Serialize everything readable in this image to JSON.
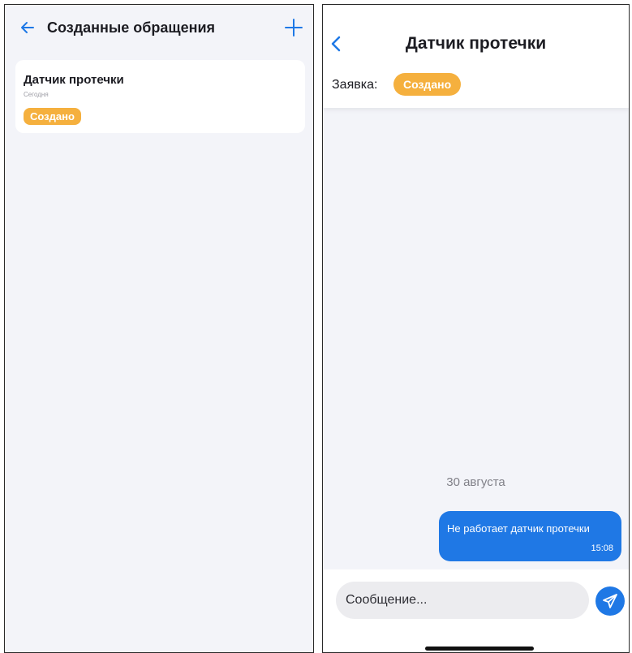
{
  "left": {
    "header": {
      "title": "Созданные обращения"
    },
    "card": {
      "title": "Датчик протечки",
      "date": "Сегодня",
      "status": "Создано"
    }
  },
  "right": {
    "header": {
      "title": "Датчик протечки",
      "request_label": "Заявка:",
      "status": "Создано"
    },
    "chat": {
      "date_separator": "30 августа",
      "messages": [
        {
          "text": "Не работает датчик протечки",
          "time": "15:08"
        }
      ]
    },
    "input": {
      "placeholder": "Сообщение..."
    }
  },
  "colors": {
    "accent": "#1f78e5",
    "status": "#f5b03e",
    "background": "#f3f4f9"
  },
  "icons": {
    "back": "arrow-left-icon",
    "add": "plus-icon",
    "chevron": "chevron-left-icon",
    "send": "send-icon"
  }
}
